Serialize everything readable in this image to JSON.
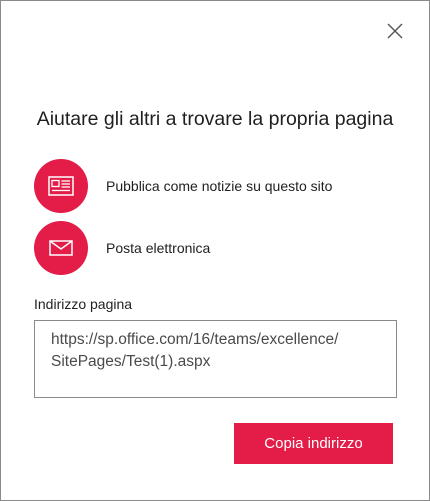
{
  "dialog": {
    "title": "Aiutare gli altri a trovare la propria pagina",
    "close_icon": "close-icon"
  },
  "share_options": [
    {
      "label": "Pubblica come notizie su questo sito",
      "icon": "newspaper-icon"
    },
    {
      "label": "Posta elettronica",
      "icon": "envelope-icon"
    }
  ],
  "address": {
    "label": "Indirizzo pagina",
    "value": "https://sp.office.com/16/teams/excellence/\nSitePages/Test(1).aspx"
  },
  "copy_button": {
    "label": "Copia indirizzo"
  },
  "colors": {
    "accent": "#e31c48",
    "text": "#1f1f1f",
    "border": "#8a8a8a"
  }
}
